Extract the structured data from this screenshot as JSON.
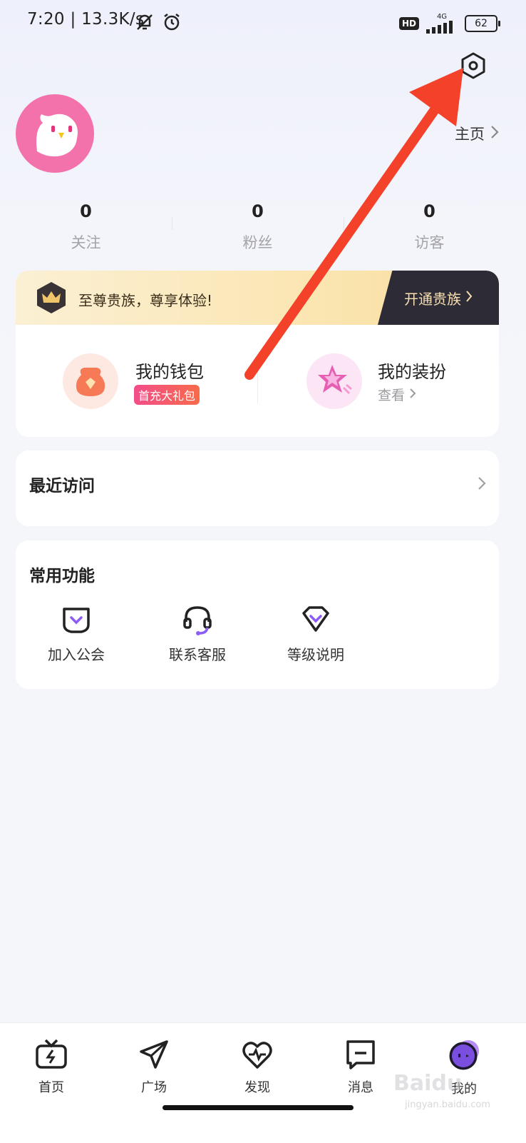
{
  "status_bar": {
    "time": "7:20 | 13.3K/s",
    "network": "4G",
    "hd": "HD",
    "battery": "62"
  },
  "profile": {
    "homepage_link": "主页",
    "stats": [
      {
        "value": "0",
        "label": "关注"
      },
      {
        "value": "0",
        "label": "粉丝"
      },
      {
        "value": "0",
        "label": "访客"
      }
    ]
  },
  "vip": {
    "text": "至尊贵族，尊享体验!",
    "button": "开通贵族"
  },
  "wallet": {
    "title": "我的钱包",
    "badge": "首充大礼包"
  },
  "dress": {
    "title": "我的装扮",
    "link": "查看"
  },
  "recent": {
    "title": "最近访问"
  },
  "functions": {
    "title": "常用功能",
    "items": [
      {
        "label": "加入公会",
        "icon": "guild-icon"
      },
      {
        "label": "联系客服",
        "icon": "headset-icon"
      },
      {
        "label": "等级说明",
        "icon": "level-icon"
      }
    ]
  },
  "nav": {
    "items": [
      {
        "label": "首页",
        "icon": "tv-icon"
      },
      {
        "label": "广场",
        "icon": "paper-plane-icon"
      },
      {
        "label": "发现",
        "icon": "heart-pulse-icon"
      },
      {
        "label": "消息",
        "icon": "message-icon"
      },
      {
        "label": "我的",
        "icon": "profile-face-icon"
      }
    ]
  },
  "watermark": {
    "text": "Baidu",
    "sub": "jingyan.baidu.com"
  },
  "colors": {
    "accent": "#f4412a",
    "avatar": "#f472ac",
    "purple": "#8b5cf6"
  }
}
